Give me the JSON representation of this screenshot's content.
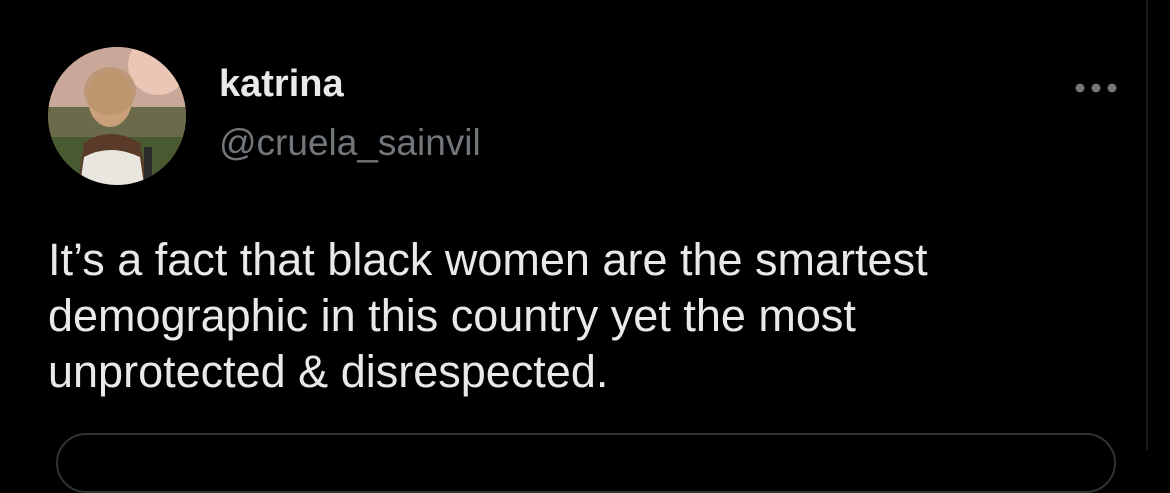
{
  "tweet": {
    "author": {
      "display_name": "katrina",
      "handle": "@cruela_sainvil",
      "avatar_icon": "profile-photo"
    },
    "more_icon": "more-horizontal-icon",
    "text": "It’s a fact that black women are the smartest\ndemographic in this country yet the most\nunprotected & disrespected."
  },
  "colors": {
    "background": "#000000",
    "primary_text": "#e7e9ea",
    "secondary_text": "#71767b",
    "border": "#2f3336"
  }
}
